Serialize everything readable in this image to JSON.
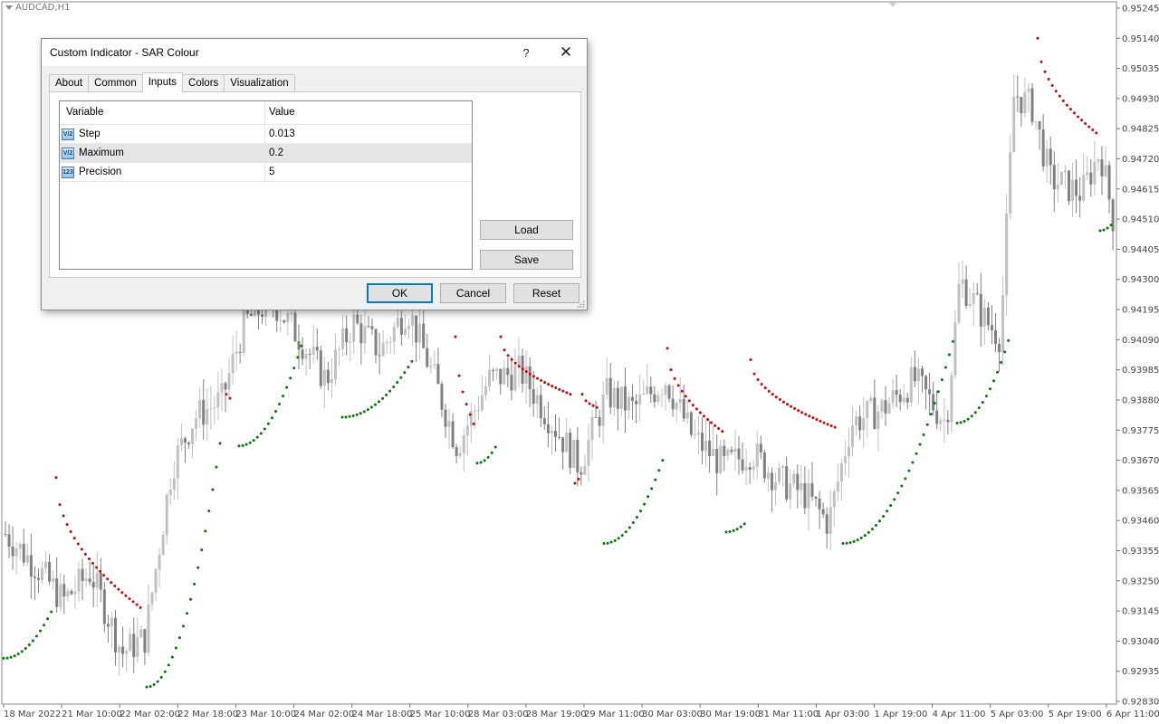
{
  "chart": {
    "symbol": "AUDCAD,H1",
    "price_labels": [
      "0.95245",
      "0.95140",
      "0.95035",
      "0.94930",
      "0.94825",
      "0.94720",
      "0.94615",
      "0.94510",
      "0.94405",
      "0.94300",
      "0.94195",
      "0.94090",
      "0.93985",
      "0.93880",
      "0.93775",
      "0.93670",
      "0.93565",
      "0.93460",
      "0.93355",
      "0.93250",
      "0.93145",
      "0.93040",
      "0.92935",
      "0.92830"
    ],
    "time_labels": [
      "18 Mar 2022",
      "21 Mar 10:00",
      "22 Mar 02:00",
      "22 Mar 18:00",
      "23 Mar 10:00",
      "24 Mar 02:00",
      "24 Mar 18:00",
      "25 Mar 10:00",
      "28 Mar 03:00",
      "28 Mar 19:00",
      "29 Mar 11:00",
      "30 Mar 03:00",
      "30 Mar 19:00",
      "31 Mar 11:00",
      "1 Apr 03:00",
      "1 Apr 19:00",
      "4 Apr 11:00",
      "5 Apr 03:00",
      "5 Apr 19:00",
      "6 Apr 11:00"
    ],
    "colors": {
      "bull": "#c0c0c0",
      "bear": "#808080",
      "sar_up": "#007a00",
      "sar_down": "#dd0000",
      "axis": "#555555"
    }
  },
  "chart_data": {
    "type": "candlestick-with-parabolic-sar",
    "timeframe": "H1",
    "ylim": [
      0.9283,
      0.95245
    ],
    "sar_segments": [
      {
        "direction": "up",
        "from": 0.9298,
        "to": 0.9315
      },
      {
        "direction": "down",
        "from": 0.9361,
        "to": 0.9315
      },
      {
        "direction": "up",
        "from": 0.9288,
        "to": 0.9375
      },
      {
        "direction": "down",
        "from": 0.942,
        "to": 0.941
      },
      {
        "direction": "up",
        "from": 0.9382,
        "to": 0.9403
      },
      {
        "direction": "down",
        "from": 0.941,
        "to": 0.9377
      },
      {
        "direction": "up",
        "from": 0.9366,
        "to": 0.9372
      },
      {
        "direction": "down",
        "from": 0.941,
        "to": 0.939
      },
      {
        "direction": "up",
        "from": 0.9338,
        "to": 0.9369
      },
      {
        "direction": "down",
        "from": 0.9406,
        "to": 0.9377
      },
      {
        "direction": "up",
        "from": 0.9342,
        "to": 0.9346
      },
      {
        "direction": "down",
        "from": 0.9402,
        "to": 0.9378
      },
      {
        "direction": "up",
        "from": 0.9338,
        "to": 0.9409
      },
      {
        "direction": "down",
        "from": 0.9514,
        "to": 0.9481
      },
      {
        "direction": "up",
        "from": 0.9447,
        "to": 0.945
      }
    ]
  },
  "dialog": {
    "title": "Custom Indicator - SAR Colour",
    "help": "?",
    "close": "✕",
    "tabs": [
      "About",
      "Common",
      "Inputs",
      "Colors",
      "Visualization"
    ],
    "active_tab": "Inputs",
    "table": {
      "headers": {
        "variable": "Variable",
        "value": "Value"
      },
      "rows": [
        {
          "icon": "V/2",
          "variable": "Step",
          "value": "0.013"
        },
        {
          "icon": "V/2",
          "variable": "Maximum",
          "value": "0.2"
        },
        {
          "icon": "123",
          "variable": "Precision",
          "value": "5"
        }
      ]
    },
    "buttons": {
      "load": "Load",
      "save": "Save",
      "ok": "OK",
      "cancel": "Cancel",
      "reset": "Reset"
    }
  }
}
